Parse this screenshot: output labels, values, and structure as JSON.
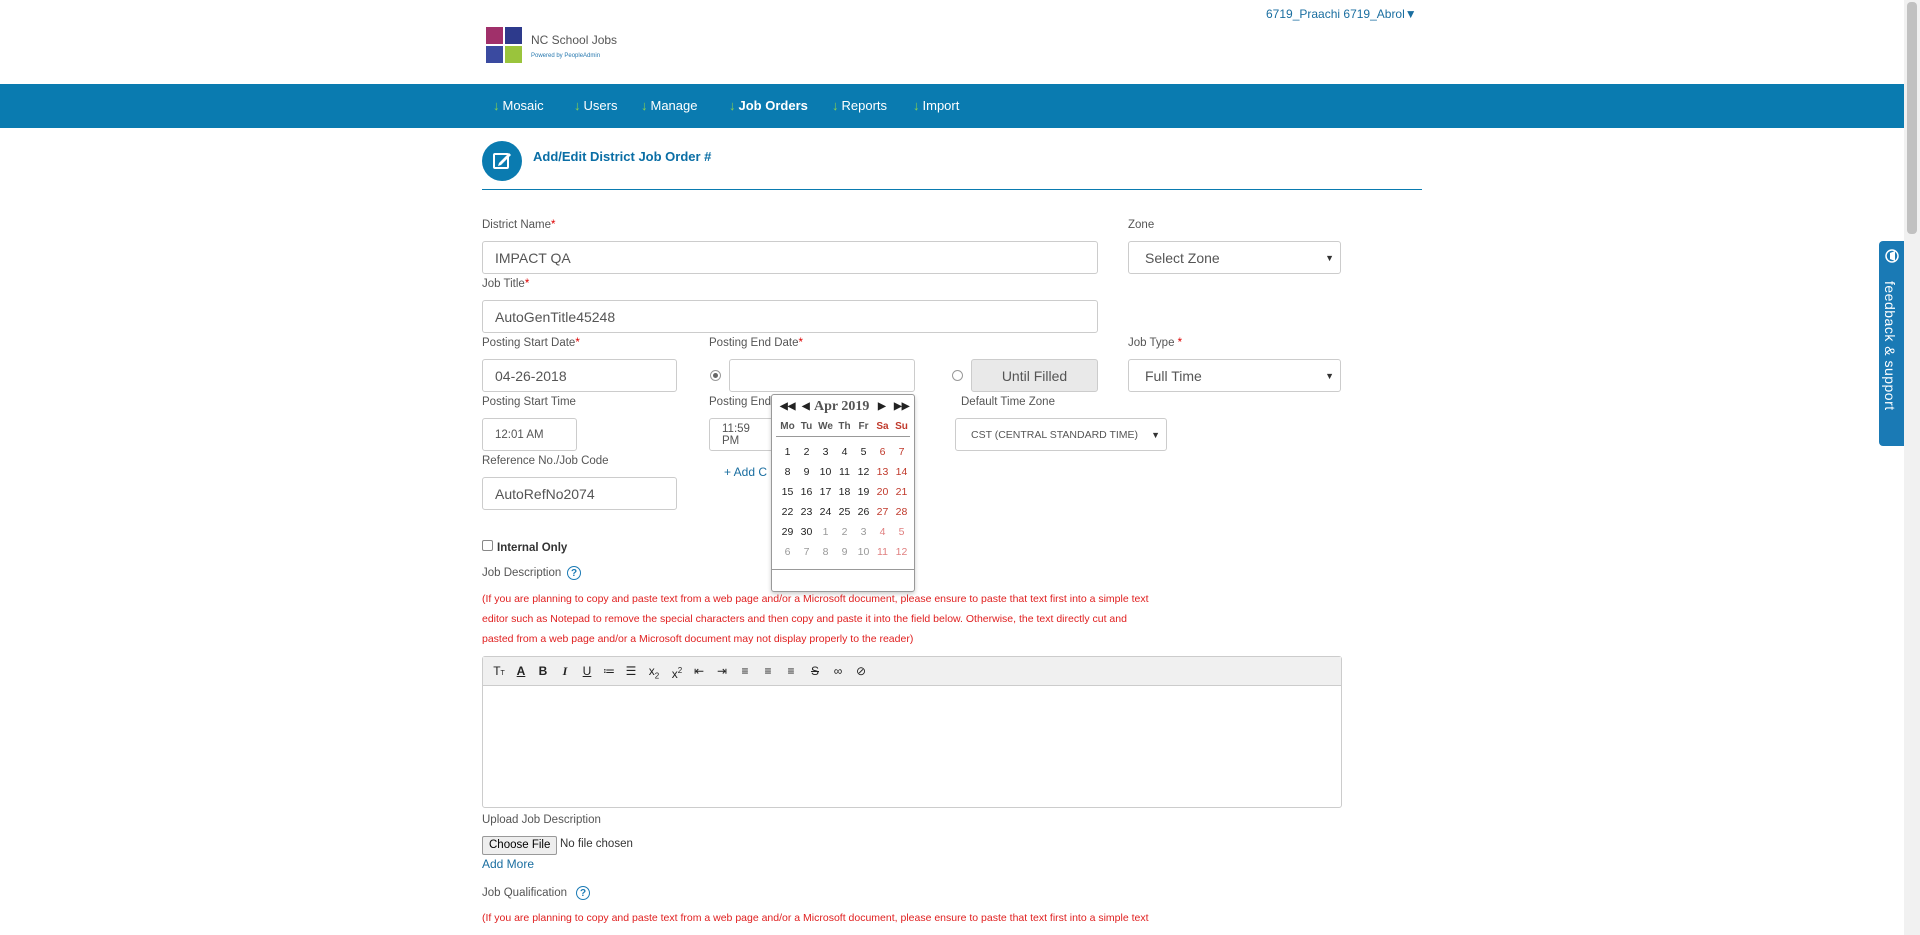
{
  "header": {
    "user_menu": "6719_Praachi 6719_Abrol",
    "logo_title": "NC School Jobs",
    "logo_sub": "Powered by PeopleAdmin"
  },
  "nav": {
    "items": [
      {
        "label": "Mosaic"
      },
      {
        "label": "Users"
      },
      {
        "label": "Manage"
      },
      {
        "label": "Job Orders"
      },
      {
        "label": "Reports"
      },
      {
        "label": "Import"
      }
    ]
  },
  "page": {
    "title": "Add/Edit District Job Order #"
  },
  "form": {
    "district_name_label": "District Name",
    "district_name_value": "IMPACT QA",
    "zone_label": "Zone",
    "zone_value": "Select Zone",
    "job_title_label": "Job Title",
    "job_title_value": "AutoGenTitle45248",
    "posting_start_date_label": "Posting Start Date",
    "posting_start_date_value": "04-26-2018",
    "posting_end_date_label": "Posting End Date",
    "posting_end_date_value": "",
    "until_filled": "Until Filled",
    "job_type_label": "Job Type",
    "job_type_value": "Full Time",
    "posting_start_time_label": "Posting Start Time",
    "posting_start_time_value": "12:01 AM",
    "posting_end_time_label": "Posting End",
    "posting_end_time_value": "11:59 PM",
    "time_zone_label": "Default Time Zone",
    "time_zone_value": "CST (CENTRAL STANDARD TIME)",
    "reference_label": "Reference No./Job Code",
    "reference_value": "AutoRefNo2074",
    "add_link": "+ Add C",
    "internal_only": "Internal Only",
    "job_description_label": "Job Description",
    "paste_warning_1": "(If you are planning to copy and paste text from a web page and/or a Microsoft document, please ensure to paste that text first into a simple text",
    "paste_warning_2": "editor such as Notepad to remove the special characters and then copy and paste it into the field below. Otherwise, the text directly cut and",
    "paste_warning_3": "pasted from a web page and/or a Microsoft document may not display properly to the reader)",
    "upload_label": "Upload Job Description",
    "choose_file": "Choose File",
    "no_file": "No file chosen",
    "add_more": "Add More",
    "job_qualification_label": "Job Qualification",
    "qual_warning_1": "(If you are planning to copy and paste text from a web page and/or a Microsoft document, please ensure to paste that text first into a simple text"
  },
  "toolbar": {
    "buttons": [
      "font-size-icon",
      "font-color-icon",
      "bold-icon",
      "italic-icon",
      "underline-icon",
      "ordered-list-icon",
      "unordered-list-icon",
      "subscript-icon",
      "superscript-icon",
      "outdent-icon",
      "indent-icon",
      "align-left-icon",
      "align-center-icon",
      "align-right-icon",
      "strikethrough-icon",
      "link-icon",
      "unlink-icon"
    ]
  },
  "datepicker": {
    "month_year": "Apr 2019",
    "weekdays": [
      "Mo",
      "Tu",
      "We",
      "Th",
      "Fr",
      "Sa",
      "Su"
    ],
    "weeks": [
      [
        "1",
        "2",
        "3",
        "4",
        "5",
        "6",
        "7"
      ],
      [
        "8",
        "9",
        "10",
        "11",
        "12",
        "13",
        "14"
      ],
      [
        "15",
        "16",
        "17",
        "18",
        "19",
        "20",
        "21"
      ],
      [
        "22",
        "23",
        "24",
        "25",
        "26",
        "27",
        "28"
      ],
      [
        "29",
        "30",
        "1",
        "2",
        "3",
        "4",
        "5"
      ],
      [
        "6",
        "7",
        "8",
        "9",
        "10",
        "11",
        "12"
      ]
    ]
  },
  "feedback": {
    "label": "feedback & support"
  }
}
